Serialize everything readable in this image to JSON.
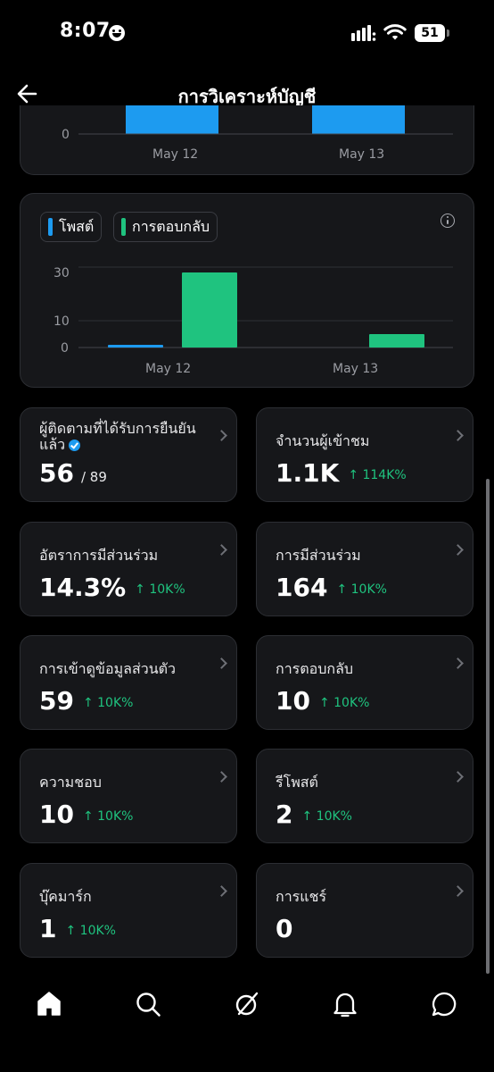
{
  "status_bar": {
    "time": "8:07",
    "battery": "51"
  },
  "header": {
    "title": "การวิเคราะห์บัญชี",
    "back_icon": "arrow-left-icon"
  },
  "chart_data": [
    {
      "type": "bar",
      "categories": [
        "May 12",
        "May 13"
      ],
      "y_ticks_visible": [
        "0"
      ],
      "series": [
        {
          "name": "",
          "color": "#1d9bf0",
          "values": [
            null,
            null
          ]
        }
      ],
      "note": "partially scrolled out of view; only baseline visible"
    },
    {
      "type": "bar",
      "categories": [
        "May 12",
        "May 13"
      ],
      "y_ticks": [
        0,
        10,
        30
      ],
      "ylim": [
        0,
        30
      ],
      "legend_placement": "top-left",
      "series": [
        {
          "name": "โพสต์",
          "color": "#1d9bf0",
          "values": [
            1,
            0
          ]
        },
        {
          "name": "การตอบกลับ",
          "color": "#1fc37f",
          "values": [
            28,
            5
          ]
        }
      ]
    }
  ],
  "legend": {
    "posts": "โพสต์",
    "replies": "การตอบกลับ"
  },
  "tick_labels": {
    "zero": "0",
    "ten": "10",
    "thirty": "30",
    "may12": "May 12",
    "may13": "May 13"
  },
  "metrics": {
    "verified_followers": {
      "label": "ผู้ติดตามที่ได้รับการยืนยันแล้ว",
      "value": "56",
      "total": "/ 89"
    },
    "impressions": {
      "label": "จำนวนผู้เข้าชม",
      "value": "1.1K",
      "delta": "↑ 114K%"
    },
    "engagement_rate": {
      "label": "อัตราการมีส่วนร่วม",
      "value": "14.3%",
      "delta": "↑ 10K%"
    },
    "engagements": {
      "label": "การมีส่วนร่วม",
      "value": "164",
      "delta": "↑ 10K%"
    },
    "profile_visits": {
      "label": "การเข้าดูข้อมูลส่วนตัว",
      "value": "59",
      "delta": "↑ 10K%"
    },
    "replies": {
      "label": "การตอบกลับ",
      "value": "10",
      "delta": "↑ 10K%"
    },
    "likes": {
      "label": "ความชอบ",
      "value": "10",
      "delta": "↑ 10K%"
    },
    "reposts": {
      "label": "รีโพสต์",
      "value": "2",
      "delta": "↑ 10K%"
    },
    "bookmarks": {
      "label": "บุ๊คมาร์ก",
      "value": "1",
      "delta": "↑ 10K%"
    },
    "shares": {
      "label": "การแชร์",
      "value": "0"
    }
  },
  "bottom_nav": [
    "home-icon",
    "search-icon",
    "grok-icon",
    "bell-icon",
    "message-icon"
  ],
  "colors": {
    "accent_blue": "#1d9bf0",
    "accent_green": "#1fc37f",
    "card_bg": "#16171a"
  }
}
